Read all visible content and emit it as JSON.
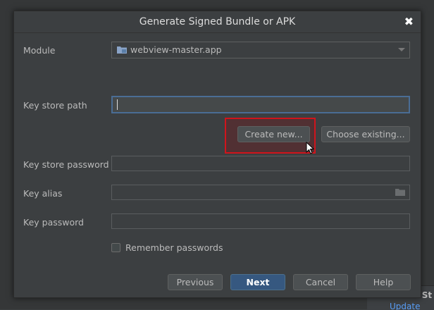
{
  "dialog": {
    "title": "Generate Signed Bundle or APK",
    "close_glyph": "✖"
  },
  "module": {
    "label": "Module",
    "value": "webview-master.app",
    "icon": "folder-icon"
  },
  "keystore": {
    "path_label": "Key store path",
    "path_value": "",
    "create_new_label": "Create new...",
    "choose_existing_label": "Choose existing...",
    "password_label": "Key store password",
    "password_value": ""
  },
  "key": {
    "alias_label": "Key alias",
    "alias_value": "",
    "password_label": "Key password",
    "password_value": ""
  },
  "remember": {
    "label": "Remember passwords",
    "checked": false
  },
  "footer": {
    "previous_label": "Previous",
    "next_label": "Next",
    "cancel_label": "Cancel",
    "help_label": "Help"
  },
  "background": {
    "peek_text": "d St",
    "peek_link": "Update"
  },
  "colors": {
    "dialog_bg": "#3c3f41",
    "primary_button": "#365880",
    "highlight": "#d0141c",
    "focus_border": "#4a6d95"
  }
}
